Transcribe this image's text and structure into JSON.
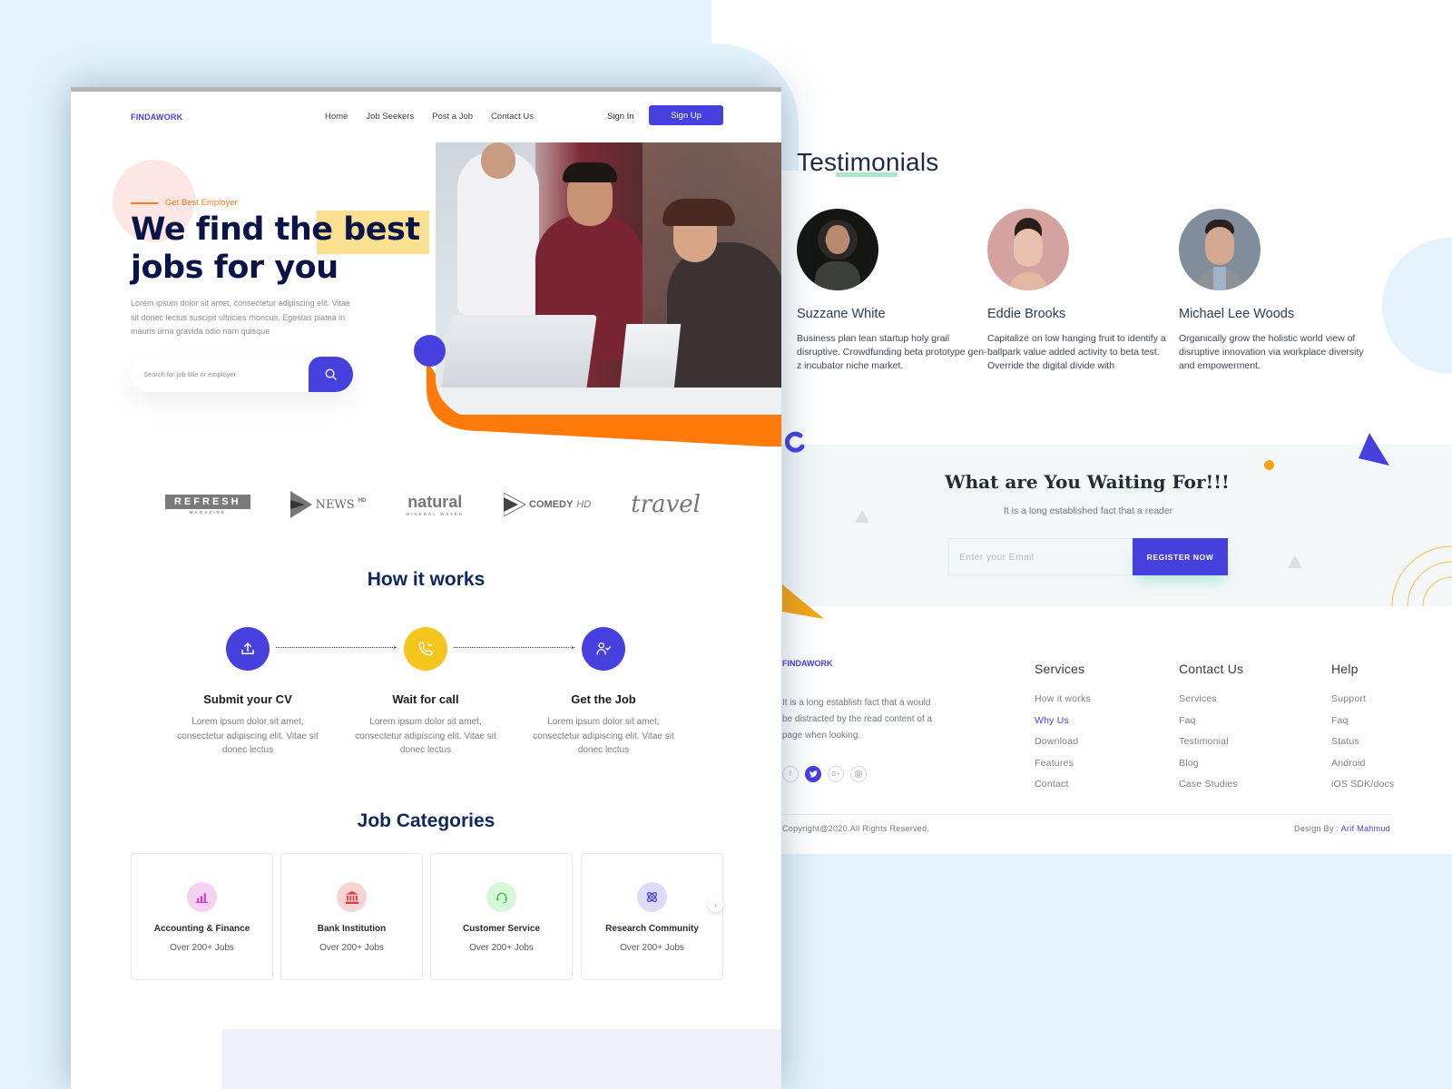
{
  "nav": {
    "logo": "FINDAWORK",
    "links": [
      "Home",
      "Job Seekers",
      "Post a Job",
      "Contact Us"
    ],
    "sign_in": "Sign In",
    "sign_up": "Sign Up"
  },
  "hero": {
    "eyebrow": "Get Best Employer",
    "title_part1": "We find the",
    "title_highlight": "best",
    "title_part2": "jobs for you",
    "description": "Lorem ipsum dolor sit amet, consectetur adipiscing elit. Vitae sit donec lectus suscipit ultricies rhoncus. Egestas platea in mauris urna gravida odio nam quisque",
    "search_placeholder": "Search for job title or employer",
    "search_icon": "search-icon"
  },
  "brands": [
    {
      "name": "REFRESH",
      "sub": "MAGAZINE"
    },
    {
      "name": "NEWS",
      "sup": "HD"
    },
    {
      "name": "natural",
      "sub": "MINERAL WATER"
    },
    {
      "name": "COMEDY",
      "suffix": "HD"
    },
    {
      "name": "travel"
    }
  ],
  "how_it_works": {
    "title": "How it works",
    "steps": [
      {
        "icon": "upload-icon",
        "title": "Submit your CV",
        "text": "Lorem ipsum dolor sit amet, consectetur adipiscing elit. Vitae sit donec lectus",
        "color": "#4640de"
      },
      {
        "icon": "phone-call-icon",
        "title": "Wait for call",
        "text": "Lorem ipsum dolor sit amet, consectetur adipiscing elit. Vitae sit donec lectus",
        "color": "#f4c51d"
      },
      {
        "icon": "user-check-icon",
        "title": "Get the Job",
        "text": "Lorem ipsum dolor sit amet, consectetur adipiscing elit. Vitae sit donec lectus",
        "color": "#4640de"
      }
    ]
  },
  "job_categories": {
    "title": "Job Categories",
    "items": [
      {
        "icon": "bar-chart-icon",
        "title": "Accounting & Finance",
        "count": "Over 200+ Jobs"
      },
      {
        "icon": "bank-icon",
        "title": "Bank Institution",
        "count": "Over 200+ Jobs"
      },
      {
        "icon": "headset-icon",
        "title": "Customer Service",
        "count": "Over 200+ Jobs"
      },
      {
        "icon": "atom-icon",
        "title": "Research Community",
        "count": "Over 200+ Jobs"
      }
    ]
  },
  "testimonials": {
    "title": "Testimonials",
    "items": [
      {
        "name": "Suzzane White",
        "quote": "Business plan lean startup holy grail disruptive. Crowdfunding beta prototype gen-z incubator niche market."
      },
      {
        "name": "Eddie Brooks",
        "quote": "Capitalize on low hanging fruit to identify a ballpark value added activity to beta test. Override the digital divide with"
      },
      {
        "name": "Michael Lee Woods",
        "quote": "Organically grow the holistic world view of disruptive innovation via workplace diversity and empowerment."
      }
    ]
  },
  "cta": {
    "title": "What are You Waiting For!!!",
    "subtitle": "It is a long established fact that a reader",
    "email_placeholder": "Enter your Email",
    "button": "REGISTER NOW"
  },
  "footer": {
    "logo": "FINDAWORK",
    "about": "It is a long establish fact that a would be distracted by the read content of a page when looking.",
    "social": [
      "facebook-icon",
      "twitter-icon",
      "google-plus-icon",
      "instagram-icon"
    ],
    "columns": [
      {
        "title": "Services",
        "links": [
          "How it works",
          "Why Us",
          "Download",
          "Features",
          "Contact"
        ],
        "active": "Why Us"
      },
      {
        "title": "Contact Us",
        "links": [
          "Services",
          "Faq",
          "Testimonial",
          "Blog",
          "Case Studies"
        ]
      },
      {
        "title": "Help",
        "links": [
          "Support",
          "Faq",
          "Status",
          "Android",
          "iOS SDK/docs"
        ]
      }
    ],
    "copyright": "Copyright@2020.All Rights Reserved.",
    "design_by_label": "Design By :",
    "design_by_name": "Arif Mahmud"
  },
  "colors": {
    "brand": "#4640de",
    "accent_orange": "#f67a1a",
    "accent_yellow": "#f4c51d",
    "highlight": "#f9e091",
    "heading": "#0b1447"
  }
}
